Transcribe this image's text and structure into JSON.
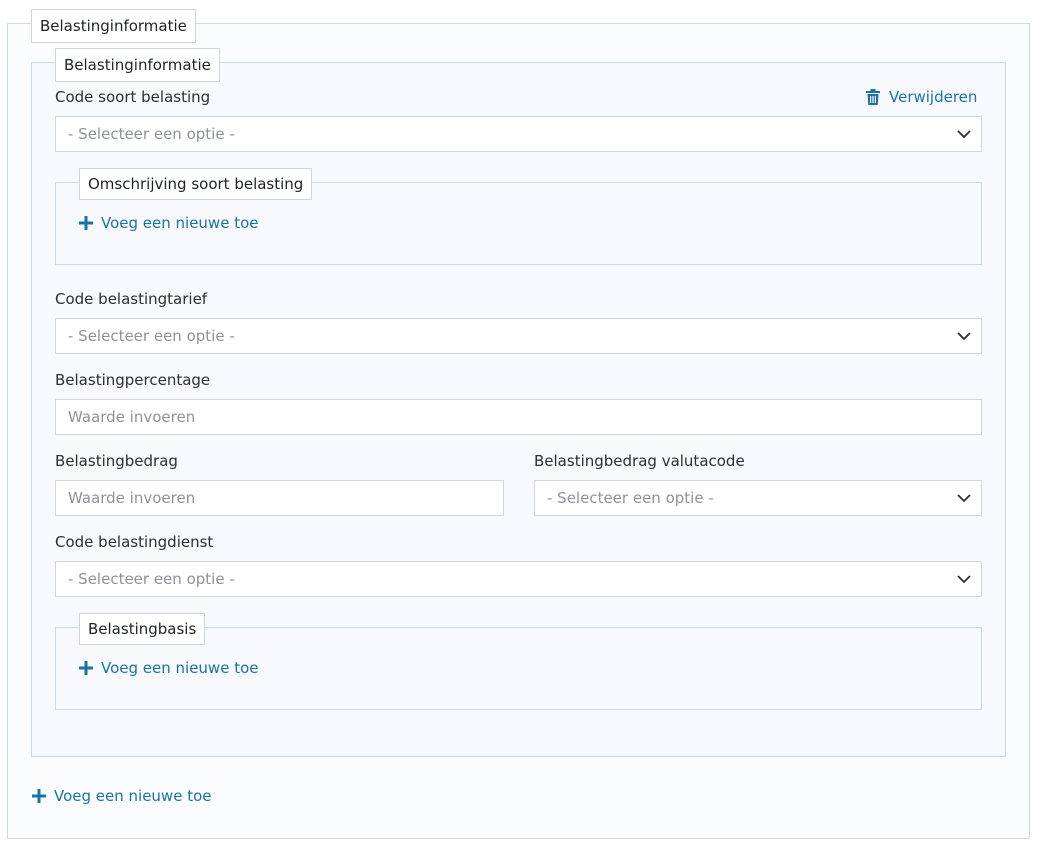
{
  "outer_legend": "Belastinginformatie",
  "inner_legend": "Belastinginformatie",
  "remove_label": "Verwijderen",
  "fields": {
    "code_soort": {
      "label": "Code soort belasting",
      "value": "- Selecteer een optie -"
    },
    "omschrijving": {
      "legend": "Omschrijving soort belasting",
      "add_label": "Voeg een nieuwe toe"
    },
    "code_tarief": {
      "label": "Code belastingtarief",
      "value": "- Selecteer een optie -"
    },
    "percentage": {
      "label": "Belastingpercentage",
      "placeholder": "Waarde invoeren"
    },
    "bedrag": {
      "label": "Belastingbedrag",
      "placeholder": "Waarde invoeren"
    },
    "valutacode": {
      "label": "Belastingbedrag valutacode",
      "value": "- Selecteer een optie -"
    },
    "dienst": {
      "label": "Code belastingdienst",
      "value": "- Selecteer een optie -"
    },
    "basis": {
      "legend": "Belastingbasis",
      "add_label": "Voeg een nieuwe toe"
    }
  },
  "outer_add_label": "Voeg een nieuwe toe",
  "colors": {
    "accent": "#1a73a6",
    "border": "#c9dbe9",
    "placeholder": "#8d9399"
  },
  "icons": {
    "remove": "trash-icon",
    "add": "plus-icon",
    "select": "chevron-down-icon"
  }
}
